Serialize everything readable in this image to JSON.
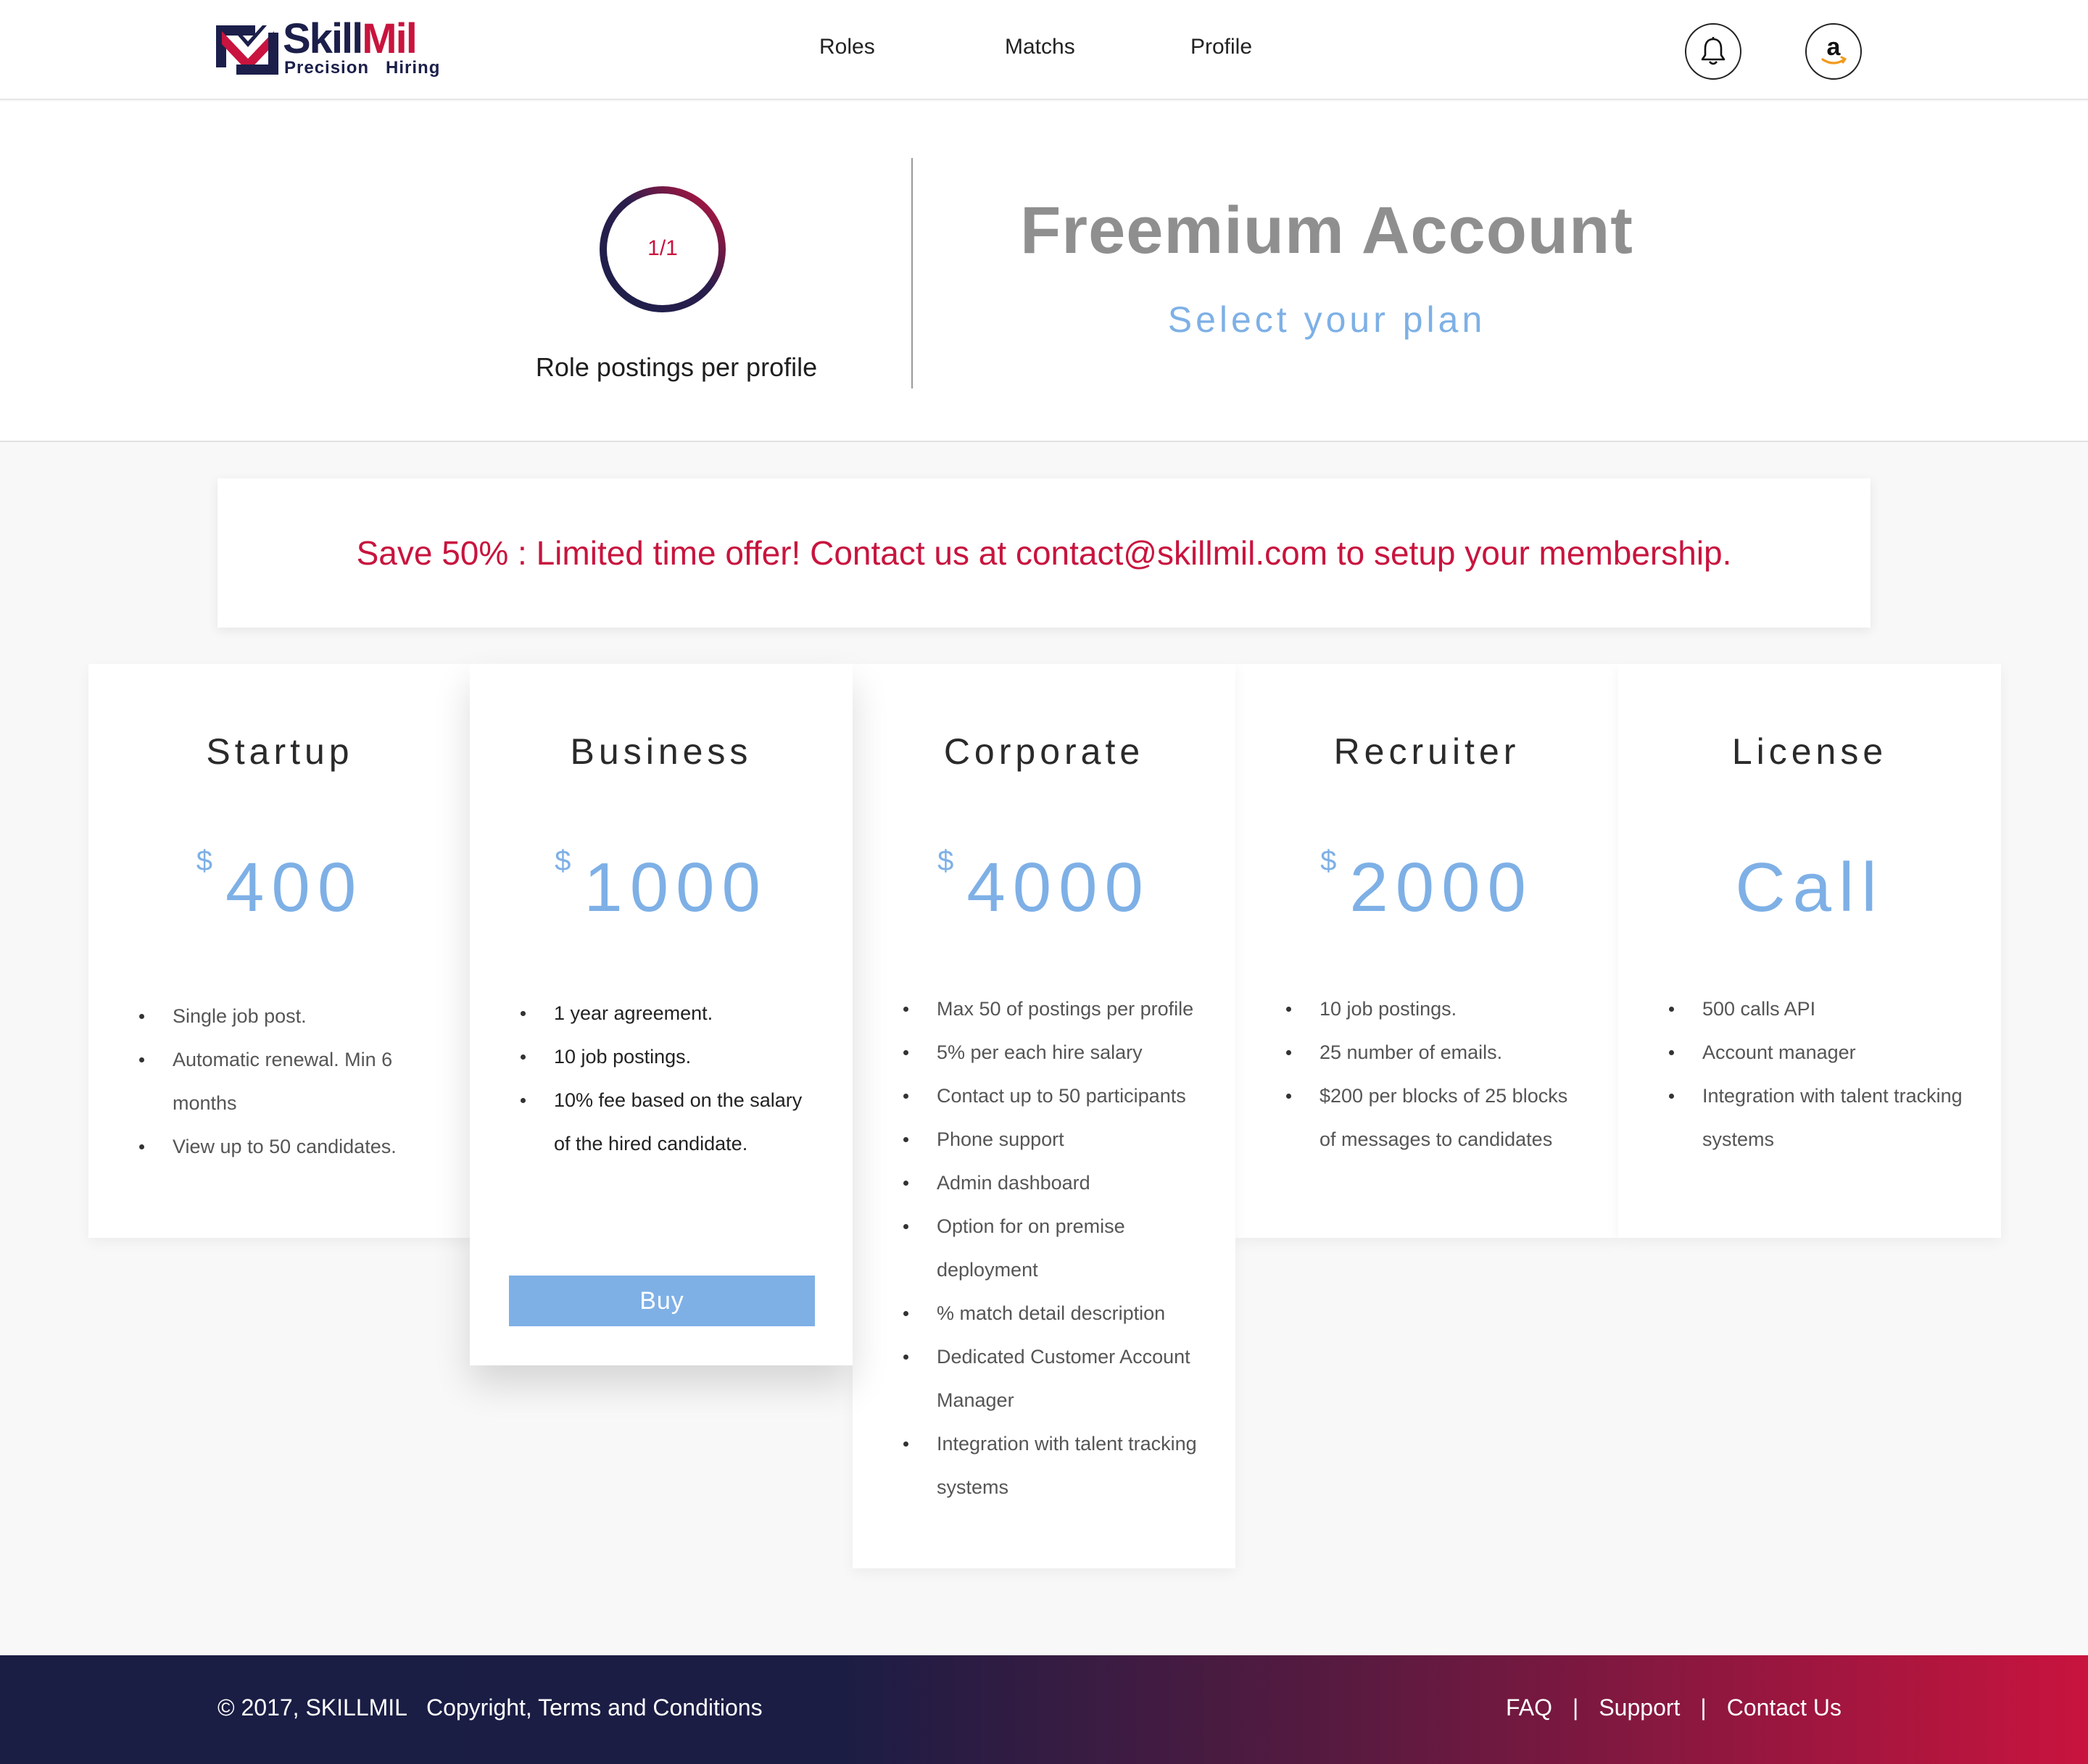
{
  "brand": {
    "name_part1": "Skill",
    "name_part2": "Mil",
    "tagline": "Precision   Hiring"
  },
  "nav": {
    "roles": "Roles",
    "matchs": "Matchs",
    "profile": "Profile"
  },
  "header_icons": {
    "notifications": "bell-icon",
    "user_avatar": "amazon-logo-icon"
  },
  "account": {
    "ring_counter": "1/1",
    "ring_fill_fraction": 1.0,
    "postings_label": "Role postings per profile",
    "title": "Freemium Account",
    "subtitle": "Select your plan"
  },
  "promo": {
    "text": "Save 50% : Limited time offer! Contact us at contact@skillmil.com to setup your membership."
  },
  "plans": [
    {
      "name": "Startup",
      "currency": "$",
      "price": "400",
      "features": [
        "Single job post.",
        "Automatic renewal. Min 6 months",
        "View up to 50 candidates."
      ]
    },
    {
      "name": "Business",
      "currency": "$",
      "price": "1000",
      "features": [
        "1 year agreement.",
        "10 job postings.",
        "10% fee based on the salary of the hired candidate."
      ],
      "button": "Buy"
    },
    {
      "name": "Corporate",
      "currency": "$",
      "price": "4000",
      "features": [
        "Max 50 of postings per profile",
        "5% per each hire salary",
        "Contact up to 50 participants",
        "Phone support",
        "Admin dashboard",
        "Option for on premise deployment",
        "% match detail description",
        "Dedicated Customer Account Manager",
        "Integration with talent tracking systems"
      ]
    },
    {
      "name": "Recruiter",
      "currency": "$",
      "price": "2000",
      "features": [
        "10 job postings.",
        "25 number of emails.",
        "$200 per blocks of 25 blocks of messages to candidates"
      ]
    },
    {
      "name": "License",
      "price": "Call",
      "features": [
        "500 calls API",
        "Account manager",
        "Integration with talent tracking systems"
      ]
    }
  ],
  "footer": {
    "copyright": "© 2017, SKILLMIL",
    "terms": "Copyright, Terms and Conditions",
    "faq": "FAQ",
    "separator": "|",
    "support": "Support",
    "contact": "Contact Us"
  },
  "colors": {
    "brand_navy": "#1b1f4a",
    "brand_red": "#c8143e",
    "accent_blue": "#7eb0e6"
  }
}
